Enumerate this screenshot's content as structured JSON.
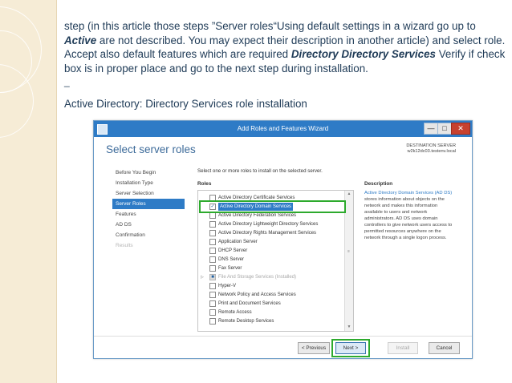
{
  "slide": {
    "paragraph": {
      "part1": "step (in this article those steps  ”Server roles“Using default settings in a wizard go up to ",
      "strong1": "Active",
      "part2": "  are not described. You may expect their description in another article) and select role. Accept also default features which are required  ",
      "strong2": "Directory Directory Services",
      "part3": " Verify if check box is in proper place and go to the next step during installation."
    },
    "dash": "_",
    "caption": "Active Directory: Directory Services role installation"
  },
  "wizard": {
    "window_title": "Add Roles and Features Wizard",
    "window_controls": {
      "minimize": "—",
      "maximize": "□",
      "close": "✕"
    },
    "page_title": "Select server roles",
    "destination": {
      "label": "DESTINATION SERVER",
      "server": "w2k12dc03.testenv.local"
    },
    "nav": [
      "Before You Begin",
      "Installation Type",
      "Server Selection",
      "Server Roles",
      "Features",
      "AD DS",
      "Confirmation",
      "Results"
    ],
    "nav_active": "Server Roles",
    "instruction": "Select one or more roles to install on the selected server.",
    "roles_label": "Roles",
    "roles": [
      {
        "label": "Active Directory Certificate Services",
        "checked": false
      },
      {
        "label": "Active Directory Domain Services",
        "checked": true,
        "selected": true
      },
      {
        "label": "Active Directory Federation Services",
        "checked": false
      },
      {
        "label": "Active Directory Lightweight Directory Services",
        "checked": false
      },
      {
        "label": "Active Directory Rights Management Services",
        "checked": false
      },
      {
        "label": "Application Server",
        "checked": false
      },
      {
        "label": "DHCP Server",
        "checked": false
      },
      {
        "label": "DNS Server",
        "checked": false
      },
      {
        "label": "Fax Server",
        "checked": false
      },
      {
        "label": "File And Storage Services (Installed)",
        "checked": true,
        "disabled": true,
        "expandable": true
      },
      {
        "label": "Hyper-V",
        "checked": false
      },
      {
        "label": "Network Policy and Access Services",
        "checked": false
      },
      {
        "label": "Print and Document Services",
        "checked": false
      },
      {
        "label": "Remote Access",
        "checked": false
      },
      {
        "label": "Remote Desktop Services",
        "checked": false
      }
    ],
    "description_label": "Description",
    "description": {
      "highlight": "Active Directory Domain Services (AD DS)",
      "rest": " stores information about objects on the network and makes this information available to users and network administrators. AD DS uses domain controllers to give network users access to permitted resources anywhere on the network through a single logon process."
    },
    "buttons": {
      "previous": "< Previous",
      "next": "Next >",
      "install": "Install",
      "cancel": "Cancel"
    }
  },
  "colors": {
    "accent": "#2e7bc6",
    "highlight_box": "#2daa2d",
    "slide_text": "#1f3b57",
    "left_band": "#f6ecd6",
    "close_button": "#c7412f"
  }
}
